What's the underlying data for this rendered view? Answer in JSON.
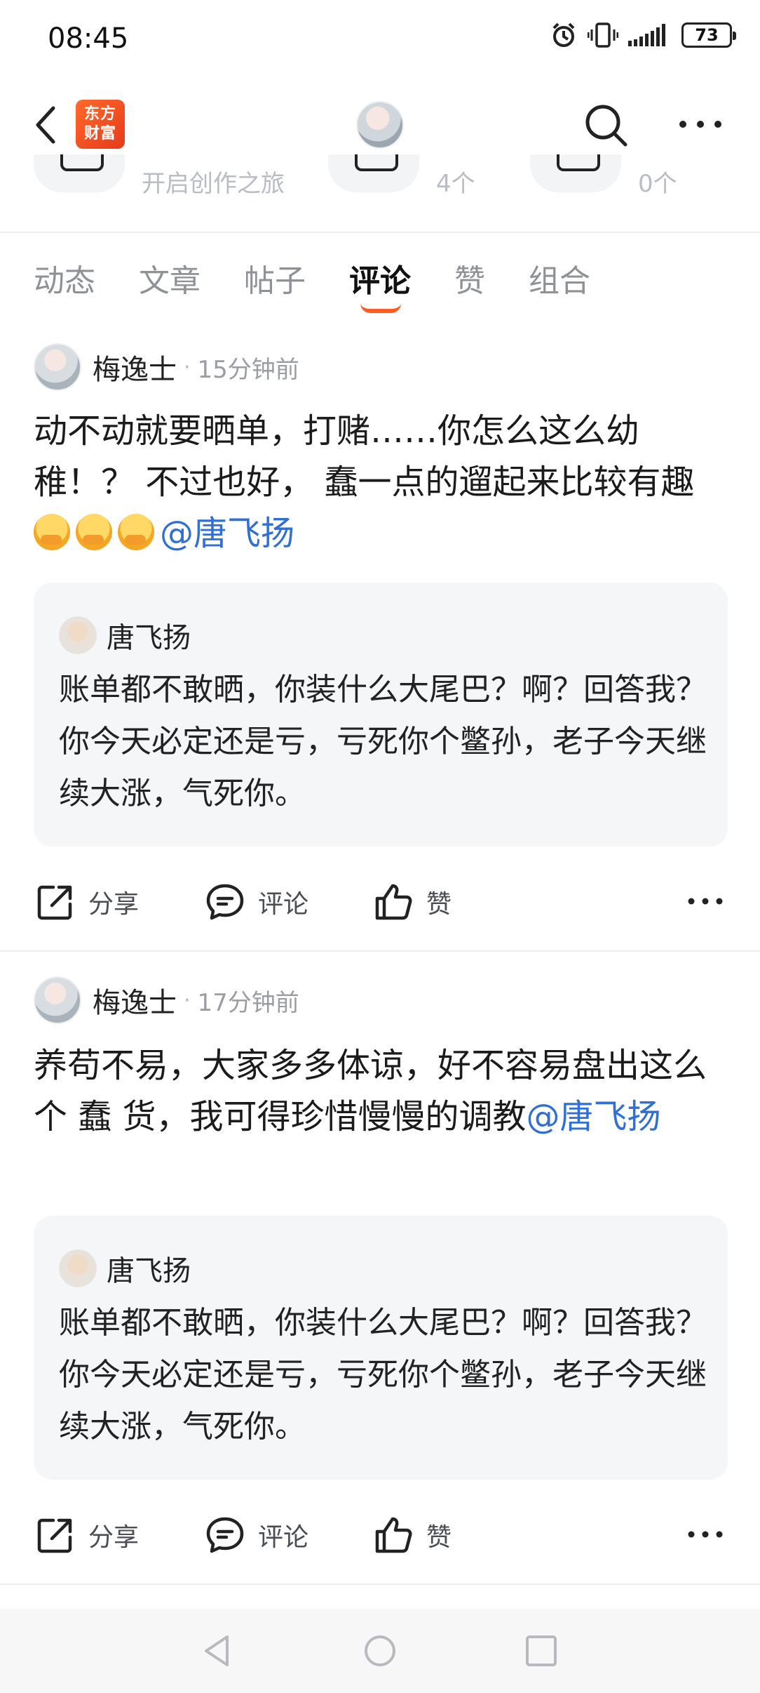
{
  "status_bar": {
    "time": "08:45",
    "battery": "73",
    "icons": [
      "alarm-icon",
      "vibrate-icon",
      "signal-icon",
      "battery-icon"
    ]
  },
  "nav": {
    "logo_line1": "东方",
    "logo_line2": "财富",
    "icons": [
      "back-icon",
      "profile-avatar",
      "search-icon",
      "more-icon"
    ]
  },
  "stats": [
    {
      "text": "开启创作之旅"
    },
    {
      "text": "4个"
    },
    {
      "text": "0个"
    }
  ],
  "tabs": [
    {
      "label": "动态",
      "active": false
    },
    {
      "label": "文章",
      "active": false
    },
    {
      "label": "帖子",
      "active": false
    },
    {
      "label": "评论",
      "active": true
    },
    {
      "label": "赞",
      "active": false
    },
    {
      "label": "组合",
      "active": false
    }
  ],
  "posts": [
    {
      "author": "梅逸士",
      "dot": "·",
      "time_ago": "15分钟前",
      "text": "动不动就要晒单，打赌……你怎么这么幼稚！？ 不过也好， 蠢一点的遛起来比较有趣",
      "emoji_count": 3,
      "mention": "@唐飞扬",
      "quote": {
        "author": "唐飞扬",
        "text": "账单都不敢晒，你装什么大尾巴？啊？回答我？你今天必定还是亏，亏死你个鳖孙，老子今天继续大涨，气死你。"
      },
      "actions": {
        "share": "分享",
        "comment": "评论",
        "like": "赞"
      }
    },
    {
      "author": "梅逸士",
      "dot": "·",
      "time_ago": "17分钟前",
      "text": "养苟不易，大家多多体谅，好不容易盘出这么个 蠢 货，我可得珍惜慢慢的调教",
      "emoji_count": 0,
      "mention": "@唐飞扬",
      "quote": {
        "author": "唐飞扬",
        "text": "账单都不敢晒，你装什么大尾巴？啊？回答我？你今天必定还是亏，亏死你个鳖孙，老子今天继续大涨，气死你。"
      },
      "actions": {
        "share": "分享",
        "comment": "评论",
        "like": "赞"
      }
    }
  ],
  "colors": {
    "accent": "#ff5a1f",
    "mention": "#2f6fd6",
    "logo": "#e73a1b"
  }
}
